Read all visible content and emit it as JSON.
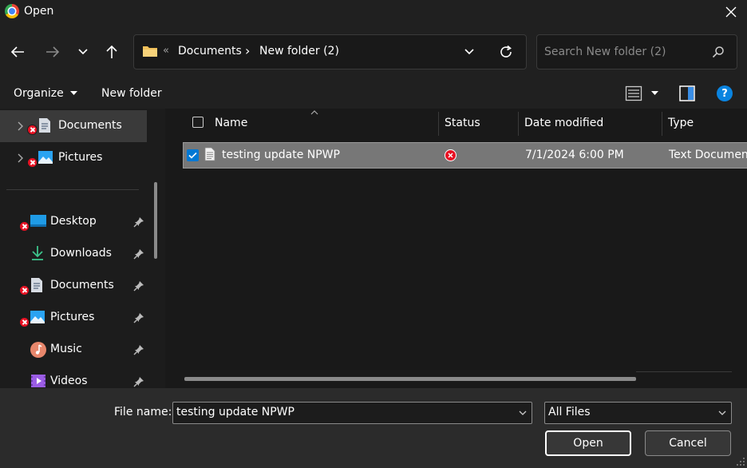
{
  "window": {
    "title": "Open"
  },
  "address": {
    "overflow_glyph": "«",
    "separator_glyph": "›",
    "crumbs": [
      "Documents",
      "New folder (2)"
    ]
  },
  "search": {
    "placeholder": "Search New folder (2)"
  },
  "toolbar": {
    "organize_label": "Organize",
    "new_folder_label": "New folder",
    "help_glyph": "?"
  },
  "sidebar": {
    "top_items": [
      {
        "label": "Documents",
        "icon": "documents-icon",
        "status": "error",
        "selected": true
      },
      {
        "label": "Pictures",
        "icon": "pictures-icon",
        "status": "error",
        "selected": false
      }
    ],
    "quick_access": [
      {
        "label": "Desktop",
        "icon": "desktop-icon",
        "status": "error",
        "pinned": true
      },
      {
        "label": "Downloads",
        "icon": "downloads-icon",
        "status": "",
        "pinned": true
      },
      {
        "label": "Documents",
        "icon": "documents-icon",
        "status": "error",
        "pinned": true
      },
      {
        "label": "Pictures",
        "icon": "pictures-icon",
        "status": "error",
        "pinned": true
      },
      {
        "label": "Music",
        "icon": "music-icon",
        "status": "",
        "pinned": true
      },
      {
        "label": "Videos",
        "icon": "videos-icon",
        "status": "",
        "pinned": true
      }
    ]
  },
  "file_list": {
    "columns": [
      "Name",
      "Status",
      "Date modified",
      "Type"
    ],
    "rows": [
      {
        "name": "testing update NPWP",
        "status": "error",
        "date_modified": "7/1/2024 6:00 PM",
        "type": "Text Document",
        "selected": true,
        "icon": "text-file-icon"
      }
    ]
  },
  "footer": {
    "file_name_label": "File name:",
    "file_name_value": "testing update NPWP",
    "file_type_value": "All Files",
    "open_label": "Open",
    "cancel_label": "Cancel"
  },
  "colors": {
    "accent": "#0078d4",
    "error": "#e81123",
    "folder": "#f0c05a"
  }
}
